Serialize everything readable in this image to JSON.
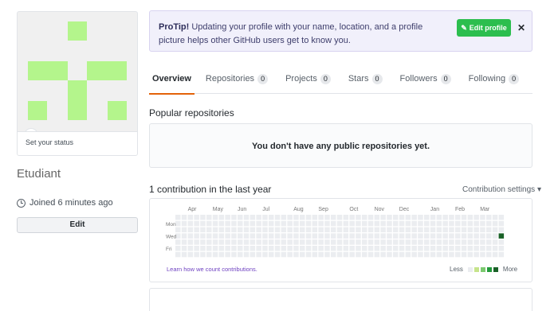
{
  "profile": {
    "status_placeholder": "Set your status",
    "username": "Etudiant",
    "joined": "Joined 6 minutes ago",
    "edit_label": "Edit",
    "identicon_color": "#b4f58c"
  },
  "protip": {
    "title": "ProTip!",
    "text": "Updating your profile with your name, location, and a profile picture helps other GitHub users get to know you.",
    "button_label": "Edit profile",
    "close_label": "✕"
  },
  "tabs": [
    {
      "label": "Overview",
      "count": ""
    },
    {
      "label": "Repositories",
      "count": "0"
    },
    {
      "label": "Projects",
      "count": "0"
    },
    {
      "label": "Stars",
      "count": "0"
    },
    {
      "label": "Followers",
      "count": "0"
    },
    {
      "label": "Following",
      "count": "0"
    }
  ],
  "popular": {
    "title": "Popular repositories",
    "empty_message": "You don't have any public repositories yet."
  },
  "contributions": {
    "title": "1 contribution in the last year",
    "settings_label": "Contribution settings ▾",
    "months": [
      "Apr",
      "May",
      "Jun",
      "Jul",
      "Aug",
      "Sep",
      "Oct",
      "Nov",
      "Dec",
      "Jan",
      "Feb",
      "Mar"
    ],
    "days": [
      "Mon",
      "Wed",
      "Fri"
    ],
    "learn_link": "Learn how we count contributions.",
    "legend_less": "Less",
    "legend_more": "More",
    "colors": [
      "#ebedf0",
      "#c6e48b",
      "#7bc96f",
      "#239a3b",
      "#196127"
    ],
    "active_day": {
      "week": 52,
      "day": 3,
      "level": 4
    }
  }
}
